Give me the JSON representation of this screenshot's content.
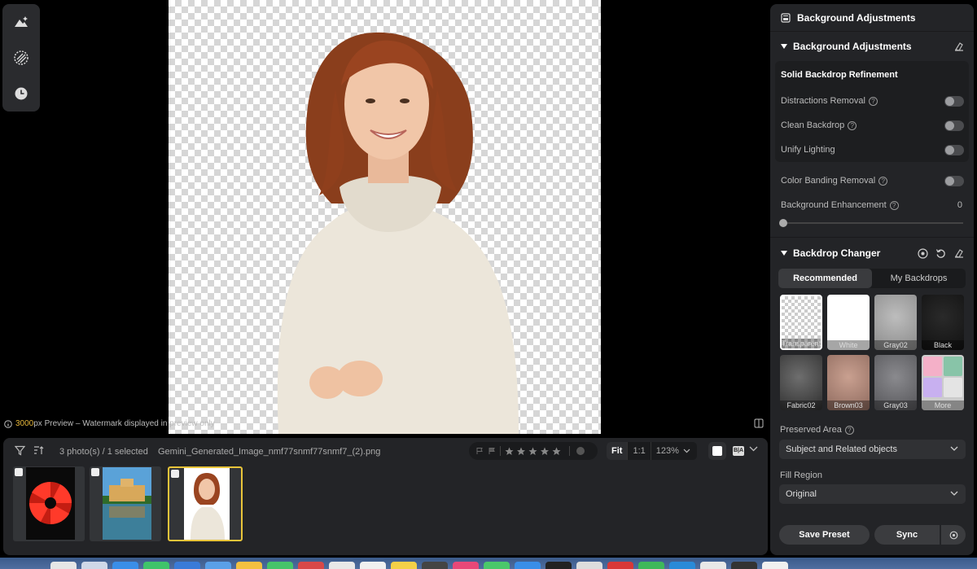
{
  "preview_note": {
    "size": "3000",
    "suffix": "px Preview – Watermark displayed in preview only"
  },
  "filmstrip": {
    "count_text": "3 photo(s) / 1 selected",
    "filename": "Gemini_Generated_Image_nmf77snmf77snmf7_(2).png",
    "zoom": {
      "fit": "Fit",
      "one_to_one": "1:1",
      "percent": "123%"
    },
    "ba_label": "B|A"
  },
  "panel": {
    "header_title": "Background Adjustments",
    "bg_section_title": "Background Adjustments",
    "refinement": {
      "title": "Solid Backdrop Refinement",
      "distractions": "Distractions Removal",
      "clean": "Clean Backdrop",
      "unify": "Unify Lighting"
    },
    "color_banding": "Color Banding Removal",
    "enhancement": {
      "label": "Background Enhancement",
      "value": "0"
    },
    "backdrop_title": "Backdrop Changer",
    "tabs": {
      "recommended": "Recommended",
      "my_backdrops": "My Backdrops"
    },
    "swatches": [
      "Transparent",
      "White",
      "Gray02",
      "Black",
      "Fabric02",
      "Brown03",
      "Gray03",
      "More"
    ],
    "preserved_area": {
      "label": "Preserved Area",
      "value": "Subject and Related objects"
    },
    "fill_region": {
      "label": "Fill Region",
      "value": "Original"
    },
    "save_preset": "Save Preset",
    "sync": "Sync"
  },
  "colors": {
    "accent": "#e8c43a",
    "panel_bg": "#232427"
  }
}
